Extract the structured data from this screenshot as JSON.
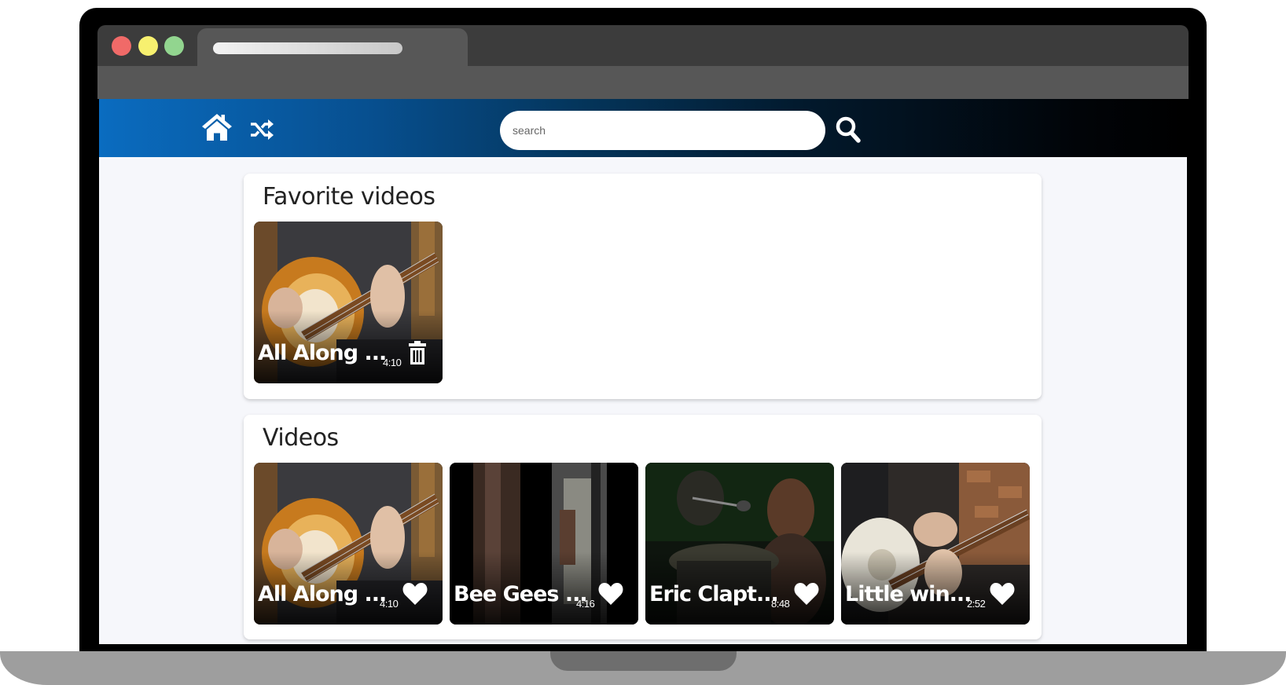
{
  "browser": {
    "dots": [
      "#f06a68",
      "#f7f06f",
      "#92d58f"
    ]
  },
  "nav": {
    "home_icon": "home-icon",
    "shuffle_icon": "shuffle-icon",
    "search_placeholder": "search",
    "search_value": "",
    "search_icon": "search-icon",
    "gradient_colors": [
      "#0a6cc0",
      "#000000"
    ]
  },
  "favorites": {
    "title": "Favorite videos",
    "items": [
      {
        "title": "All Along ...",
        "duration": "4:10",
        "action_icon": "trash-icon"
      }
    ]
  },
  "videos": {
    "title": "Videos",
    "items": [
      {
        "title": "All Along ...",
        "duration": "4:10",
        "action_icon": "heart-icon"
      },
      {
        "title": "Bee Gees ...",
        "duration": "4:16",
        "action_icon": "heart-icon"
      },
      {
        "title": "Eric Clapt...",
        "duration": "8:48",
        "action_icon": "heart-icon"
      },
      {
        "title": "Little win...",
        "duration": "2:52",
        "action_icon": "heart-icon"
      }
    ]
  }
}
